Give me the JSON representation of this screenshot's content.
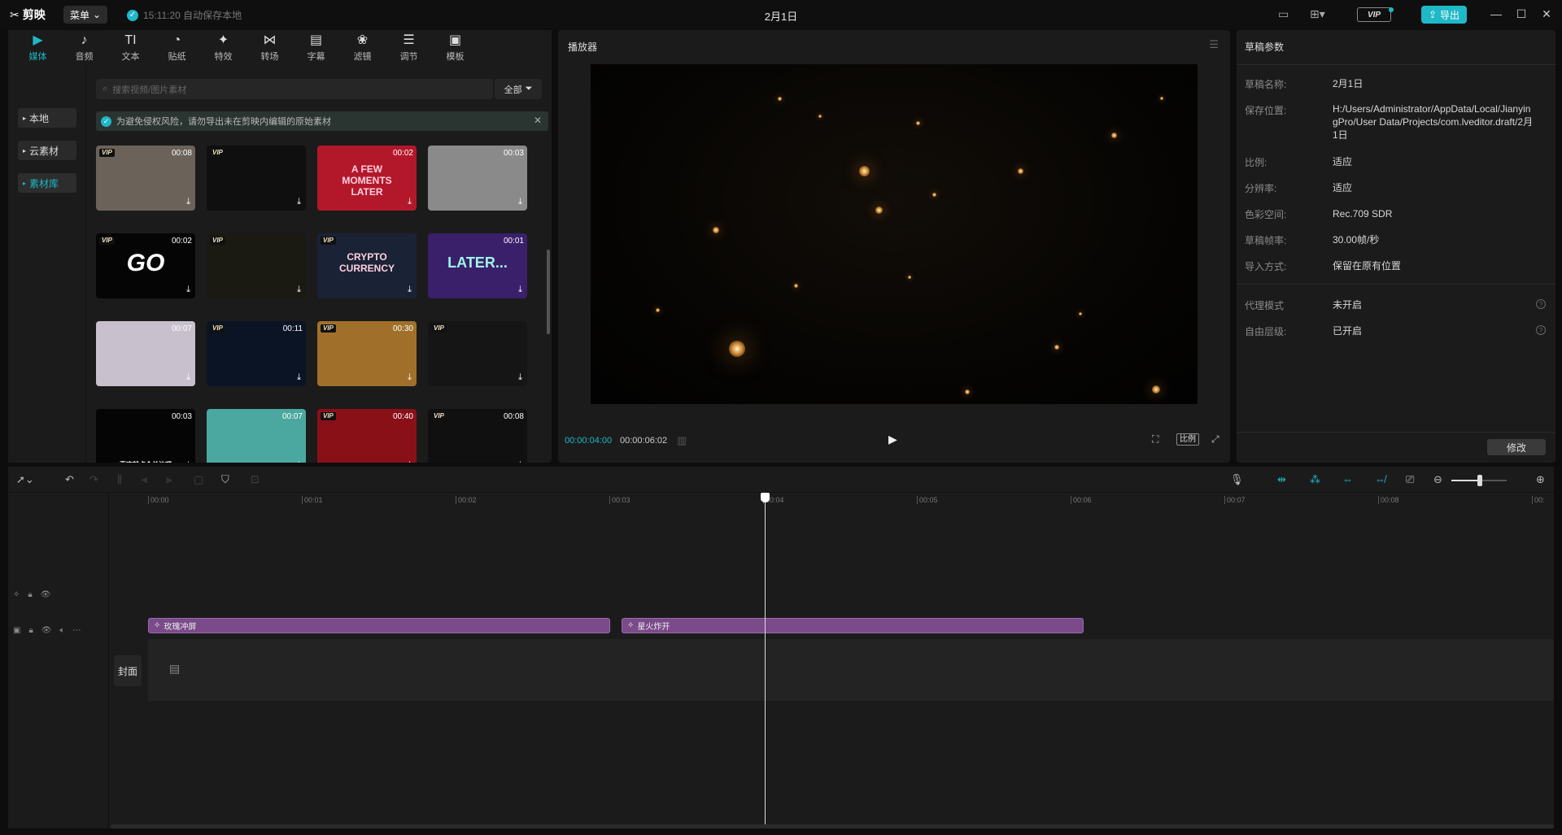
{
  "app": {
    "name": "剪映",
    "menu_label": "菜单",
    "autosave": "15:11:20 自动保存本地",
    "doc_title": "2月1日",
    "export_label": "导出",
    "vip_label": "VIP"
  },
  "tabs": [
    {
      "label": "媒体",
      "icon": "media-icon"
    },
    {
      "label": "音频",
      "icon": "audio-icon"
    },
    {
      "label": "文本",
      "icon": "text-icon"
    },
    {
      "label": "贴纸",
      "icon": "sticker-icon"
    },
    {
      "label": "特效",
      "icon": "effect-icon"
    },
    {
      "label": "转场",
      "icon": "transition-icon"
    },
    {
      "label": "字幕",
      "icon": "subtitle-icon"
    },
    {
      "label": "滤镜",
      "icon": "filter-icon"
    },
    {
      "label": "调节",
      "icon": "adjust-icon"
    },
    {
      "label": "模板",
      "icon": "template-icon"
    }
  ],
  "sidebar": {
    "items": [
      {
        "label": "本地"
      },
      {
        "label": "云素材"
      },
      {
        "label": "素材库"
      }
    ]
  },
  "search": {
    "placeholder": "搜索视频/图片素材",
    "filter_label": "全部"
  },
  "notice": {
    "text": "为避免侵权风险，请勿导出未在剪映内编辑的原始素材"
  },
  "thumbs": [
    {
      "vip": true,
      "duration": "00:08",
      "bg": "#6b6259",
      "text": ""
    },
    {
      "vip": true,
      "duration": "",
      "bg": "#0f0f0f",
      "text": ""
    },
    {
      "vip": false,
      "duration": "00:02",
      "bg": "#b3182a",
      "text": "A FEW MOMENTS LATER"
    },
    {
      "vip": false,
      "duration": "00:03",
      "bg": "#8a8a8a",
      "text": ""
    },
    {
      "vip": true,
      "duration": "00:02",
      "bg": "#050505",
      "text": "GO"
    },
    {
      "vip": true,
      "duration": "",
      "bg": "#1a1a12",
      "text": ""
    },
    {
      "vip": true,
      "duration": "",
      "bg": "#1a2236",
      "text": "CRYPTO CURRENCY"
    },
    {
      "vip": false,
      "duration": "00:01",
      "bg": "#3a1f6a",
      "text": "LATER..."
    },
    {
      "vip": false,
      "duration": "00:07",
      "bg": "#c8c0cc",
      "text": ""
    },
    {
      "vip": true,
      "duration": "00:11",
      "bg": "#0a1424",
      "text": ""
    },
    {
      "vip": true,
      "duration": "00:30",
      "bg": "#a0702a",
      "text": ""
    },
    {
      "vip": true,
      "duration": "",
      "bg": "#151515",
      "text": ""
    },
    {
      "vip": false,
      "duration": "00:03",
      "bg": "#050505",
      "text": "喜欢就点个关注吧"
    },
    {
      "vip": false,
      "duration": "00:07",
      "bg": "#4aa8a0",
      "text": ""
    },
    {
      "vip": true,
      "duration": "00:40",
      "bg": "#8a1018",
      "text": ""
    },
    {
      "vip": true,
      "duration": "00:08",
      "bg": "#101010",
      "text": ""
    }
  ],
  "player": {
    "title": "播放器",
    "current_time": "00:00:04:00",
    "total_time": "00:00:06:02",
    "ratio_label": "比例"
  },
  "params": {
    "title": "草稿参数",
    "rows": [
      {
        "label": "草稿名称:",
        "value": "2月1日"
      },
      {
        "label": "保存位置:",
        "value": "H:/Users/Administrator/AppData/Local/JianyingPro/User Data/Projects/com.lveditor.draft/2月1日"
      },
      {
        "label": "比例:",
        "value": "适应"
      },
      {
        "label": "分辨率:",
        "value": "适应"
      },
      {
        "label": "色彩空间:",
        "value": "Rec.709 SDR"
      },
      {
        "label": "草稿帧率:",
        "value": "30.00帧/秒"
      },
      {
        "label": "导入方式:",
        "value": "保留在原有位置"
      },
      {
        "label": "代理模式",
        "value": "未开启"
      },
      {
        "label": "自由层级:",
        "value": "已开启"
      }
    ],
    "modify_label": "修改"
  },
  "timeline": {
    "ticks": [
      "00:00",
      "00:01",
      "00:02",
      "00:03",
      "00:04",
      "00:05",
      "00:06",
      "00:07",
      "00:08",
      "00:"
    ],
    "clips": [
      {
        "label": "玫瑰冲屏"
      },
      {
        "label": "星火炸开"
      }
    ],
    "cover_label": "封面",
    "zoom_level": 0.5
  },
  "colors": {
    "accent": "#1fb8c6",
    "clip": "#7a4a8a"
  }
}
